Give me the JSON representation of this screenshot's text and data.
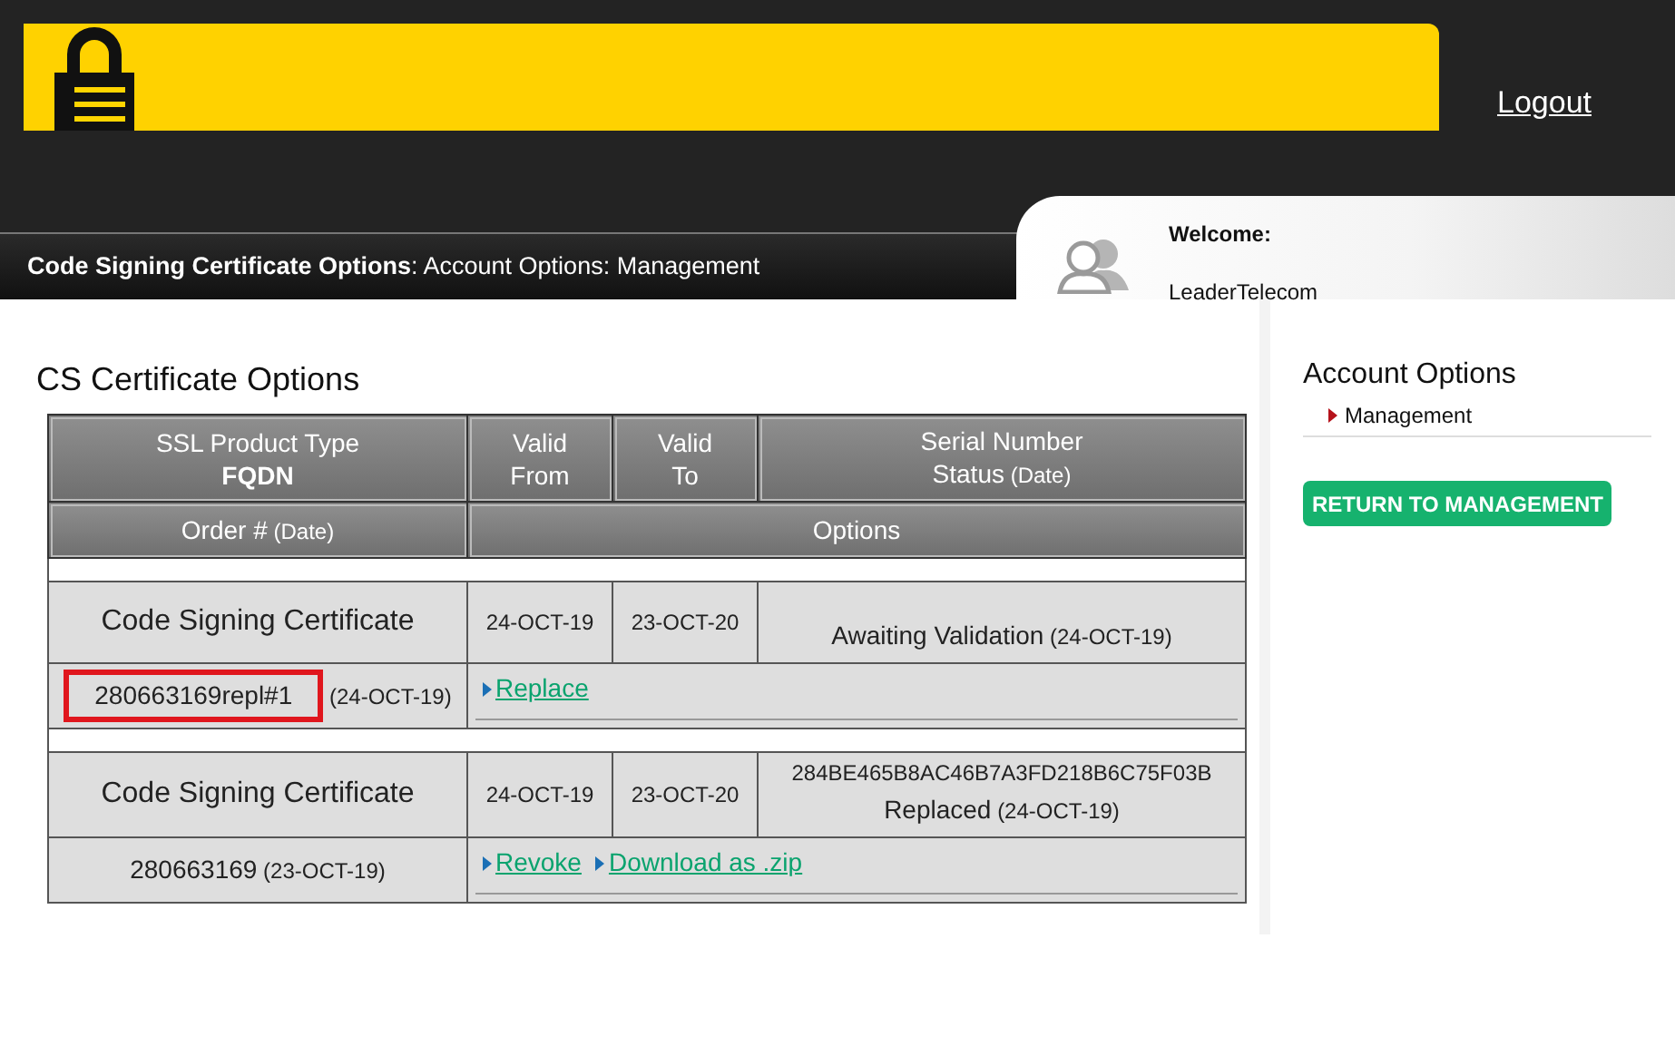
{
  "header": {
    "logout": "Logout",
    "breadcrumb": {
      "current": "Code Signing Certificate Options",
      "trail": ": Account Options: Management"
    },
    "welcome": {
      "label": "Welcome:",
      "user": "LeaderTelecom"
    }
  },
  "main": {
    "title": "CS Certificate Options",
    "table": {
      "head1": [
        {
          "line1": "SSL Product Type",
          "line2": "FQDN",
          "bold2": true
        },
        {
          "line1": "Valid",
          "line2": "From",
          "bold2": false
        },
        {
          "line1": "Valid",
          "line2": "To",
          "bold2": false
        },
        {
          "line1": "Serial Number",
          "line2": "Status",
          "date": "(Date)",
          "bold2": false
        }
      ],
      "head2": [
        {
          "label": "Order #",
          "date": "(Date)"
        },
        {
          "label": "Options"
        }
      ],
      "rows": [
        {
          "product": "Code Signing Certificate",
          "from": "24-OCT-19",
          "to": "23-OCT-20",
          "status": "Awaiting Validation",
          "status_date": "(24-OCT-19)",
          "order": "280663169repl#1",
          "order_date": "(24-OCT-19)",
          "highlighted": true,
          "options": [
            "Replace"
          ]
        },
        {
          "product": "Code Signing Certificate",
          "from": "24-OCT-19",
          "to": "23-OCT-20",
          "serial": "284BE465B8AC46B7A3FD218B6C75F03B",
          "status": "Replaced",
          "status_date": "(24-OCT-19)",
          "order": "280663169",
          "order_date": "(23-OCT-19)",
          "highlighted": false,
          "options": [
            "Revoke",
            "Download as .zip"
          ]
        }
      ]
    }
  },
  "sidebar": {
    "title": "Account Options",
    "items": [
      "Management"
    ],
    "button": "RETURN TO MANAGEMENT"
  }
}
